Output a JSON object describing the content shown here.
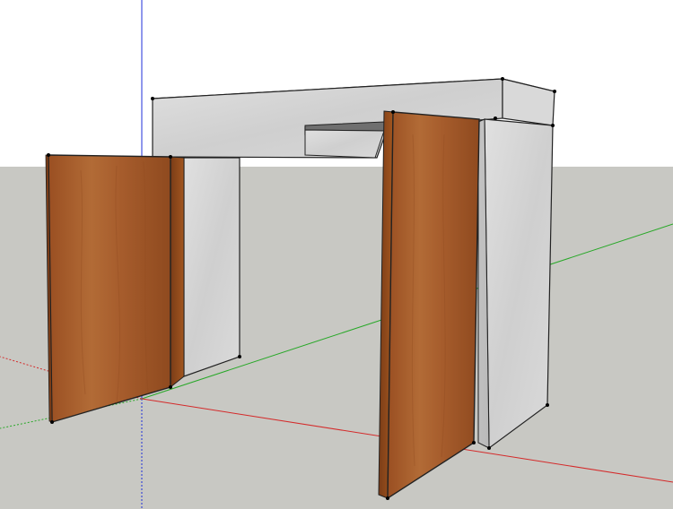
{
  "app": {
    "name": ""
  },
  "scene": {
    "sky_color": "#ffffff",
    "ground_color": "#c8c8c3",
    "axes": {
      "x_color": "#d42a2a",
      "y_color": "#27a827",
      "z_color": "#1f2fd8"
    },
    "materials": {
      "stone": "#d2d2d2",
      "wood": "#a6582a"
    },
    "objects": [
      "stone-beam",
      "stone-pillar-left",
      "stone-pillar-right",
      "stone-shelf",
      "wood-door-left",
      "wood-door-right"
    ]
  }
}
